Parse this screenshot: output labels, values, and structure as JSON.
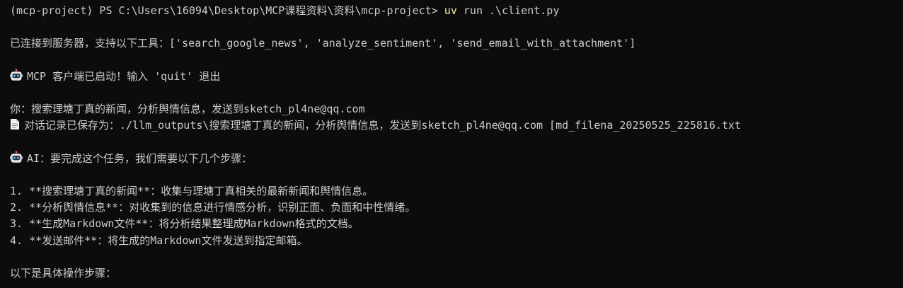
{
  "terminal": {
    "prompt": "(mcp-project) PS C:\\Users\\16094\\Desktop\\MCP课程资料\\资料\\mcp-project> ",
    "command_uv": "uv",
    "command_args": " run .\\client.py",
    "connected": "已连接到服务器，支持以下工具：['search_google_news', 'analyze_sentiment', 'send_email_with_attachment']",
    "client_started": "MCP 客户端已启动！输入 'quit' 退出",
    "user_input": "你：搜索理塘丁真的新闻，分析舆情信息，发送到sketch_pl4ne@qq.com",
    "saved_record": "对话记录已保存为：./llm_outputs\\搜索理塘丁真的新闻，分析舆情信息，发送到sketch_pl4ne@qq.com [md_filena_20250525_225816.txt",
    "ai_reply": "AI：要完成这个任务，我们需要以下几个步骤：",
    "steps": [
      "1. **搜索理塘丁真的新闻**：收集与理塘丁真相关的最新新闻和舆情信息。",
      "2. **分析舆情信息**：对收集到的信息进行情感分析，识别正面、负面和中性情绪。",
      "3. **生成Markdown文件**：将分析结果整理成Markdown格式的文档。",
      "4. **发送邮件**：将生成的Markdown文件发送到指定邮箱。"
    ],
    "closing": "以下是具体操作步骤：",
    "icons": {
      "robot": "robot-icon",
      "document": "document-icon"
    },
    "colors": {
      "background": "#0c0c0c",
      "text": "#cccccc",
      "command": "#f9f1a5"
    }
  }
}
